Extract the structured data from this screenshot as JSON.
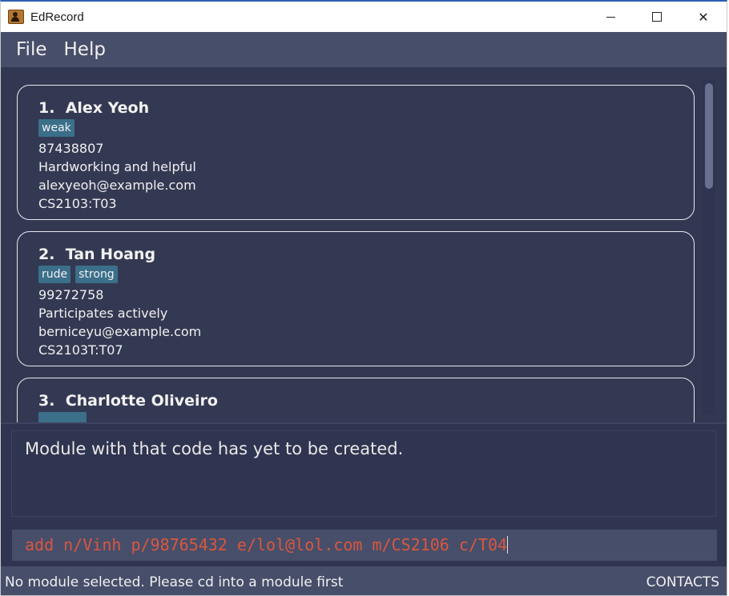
{
  "window": {
    "title": "EdRecord",
    "controls": {
      "minimize": "minimize",
      "maximize": "maximize",
      "close": "✕"
    }
  },
  "menu": {
    "items": [
      "File",
      "Help"
    ]
  },
  "persons": [
    {
      "index": "1.",
      "name": "Alex Yeoh",
      "tags": [
        "weak"
      ],
      "phone": "87438807",
      "info": "Hardworking and helpful",
      "email": "alexyeoh@example.com",
      "module": "CS2103:T03"
    },
    {
      "index": "2.",
      "name": "Tan Hoang",
      "tags": [
        "rude",
        "strong"
      ],
      "phone": "99272758",
      "info": "Participates actively",
      "email": "berniceyu@example.com",
      "module": "CS2103T:T07"
    },
    {
      "index": "3.",
      "name": "Charlotte Oliveiro",
      "tags": [
        ""
      ],
      "phone": "",
      "info": "",
      "email": "",
      "module": ""
    }
  ],
  "result": {
    "message": "Module with that code has yet to be created."
  },
  "command": {
    "value": "add n/Vinh p/98765432 e/lol@lol.com m/CS2106 c/T04"
  },
  "status": {
    "left": "No module selected. Please cd into a module first",
    "right": "CONTACTS"
  },
  "colors": {
    "background": "#2f3450",
    "menu": "#474e6a",
    "tag": "#3b6f8a",
    "command_text": "#d9573f"
  }
}
